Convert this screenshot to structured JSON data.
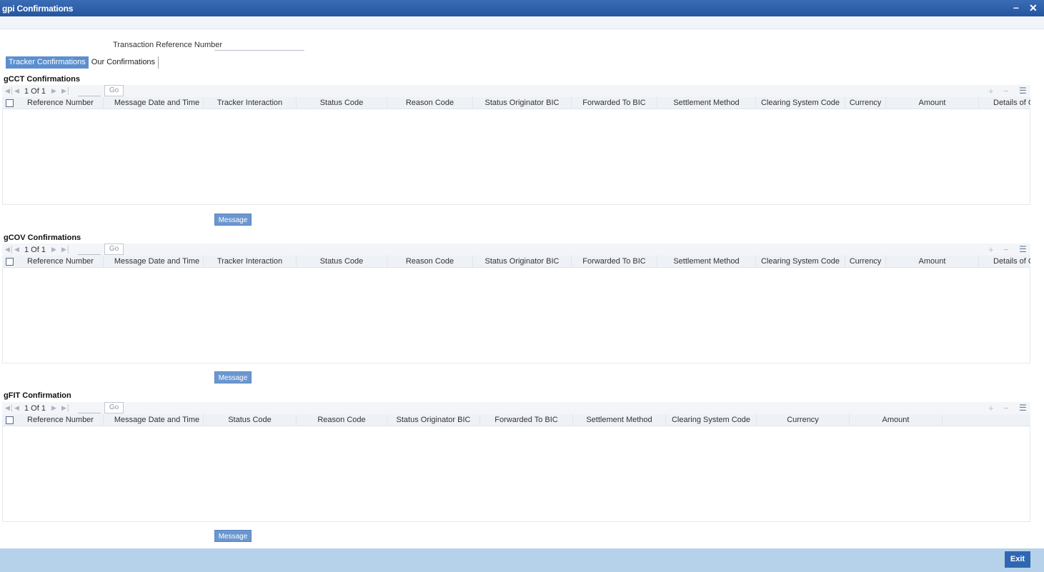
{
  "window": {
    "title": "gpi Confirmations",
    "minimize_glyph": "–",
    "close_glyph": "✕"
  },
  "form": {
    "trn_label": "Transaction Reference Number",
    "trn_value": ""
  },
  "tabs": [
    {
      "label": "Tracker Confirmations",
      "active": true
    },
    {
      "label": "Our Confirmations",
      "active": false
    }
  ],
  "pager": {
    "page_text": "1 Of 1",
    "go_label": "Go"
  },
  "sections": {
    "gcct": {
      "title": "gCCT Confirmations",
      "columns": [
        "Reference Number",
        "Message Date and Time",
        "Tracker Interaction",
        "Status Code",
        "Reason Code",
        "Status Originator BIC",
        "Forwarded To BIC",
        "Settlement Method",
        "Clearing System Code",
        "Currency",
        "Amount",
        "Details of Ch"
      ],
      "rows": [],
      "message_button": "Message"
    },
    "gcov": {
      "title": "gCOV Confirmations",
      "columns": [
        "Reference Number",
        "Message Date and Time",
        "Tracker Interaction",
        "Status Code",
        "Reason Code",
        "Status Originator BIC",
        "Forwarded To BIC",
        "Settlement Method",
        "Clearing System Code",
        "Currency",
        "Amount",
        "Details of Ch"
      ],
      "rows": [],
      "message_button": "Message"
    },
    "gfit": {
      "title": "gFIT Confirmation",
      "columns": [
        "Reference Number",
        "Message Date and Time",
        "Status Code",
        "Reason Code",
        "Status Originator BIC",
        "Forwarded To BIC",
        "Settlement Method",
        "Clearing System Code",
        "Currency",
        "Amount"
      ],
      "rows": [],
      "message_button": "Message"
    }
  },
  "footer": {
    "exit_label": "Exit"
  },
  "colors": {
    "titlebar": "#2c5ea8",
    "tab_active": "#5b8fd0",
    "button": "#6b97d0",
    "footer": "#b6d2ea",
    "exit": "#2f67b2"
  }
}
